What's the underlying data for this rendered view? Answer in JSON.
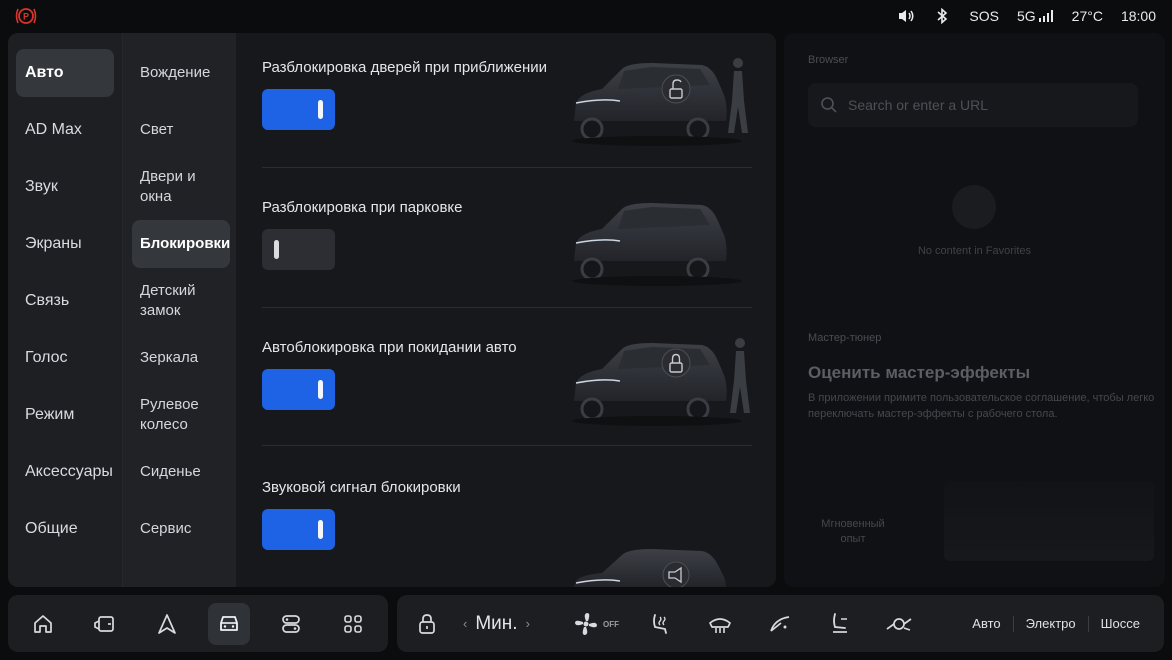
{
  "status": {
    "sos": "SOS",
    "network": "5G",
    "temperature": "27°C",
    "time": "18:00",
    "icons": [
      "parking-brake-icon",
      "volume-icon",
      "bluetooth-icon",
      "signal-icon"
    ],
    "alert_color": "#d9342b"
  },
  "nav_main": {
    "items": [
      "Авто",
      "AD Max",
      "Звук",
      "Экраны",
      "Связь",
      "Голос",
      "Режим",
      "Аксессуары",
      "Общие"
    ],
    "active": "Авто"
  },
  "nav_sub": {
    "items": [
      "Вождение",
      "Свет",
      "Двери и окна",
      "Блокировки",
      "Детский замок",
      "Зеркала",
      "Рулевое колесо",
      "Сиденье",
      "Сервис"
    ],
    "active": "Блокировки"
  },
  "settings": [
    {
      "label": "Разблокировка дверей при приближении",
      "enabled": true,
      "illustration": "car-unlock-person-icon"
    },
    {
      "label": "Разблокировка при парковке",
      "enabled": false,
      "illustration": "car-icon"
    },
    {
      "label": "Автоблокировка при покидании авто",
      "enabled": true,
      "illustration": "car-lock-person-icon"
    },
    {
      "label": "Звуковой сигнал блокировки",
      "enabled": true,
      "illustration": "car-horn-icon"
    }
  ],
  "accent_color": "#1e63e6",
  "browser": {
    "title": "Browser",
    "placeholder": "Search or enter a URL",
    "empty_text": "No content in Favorites"
  },
  "tuner": {
    "title": "Мастер-тюнер",
    "heading": "Оценить мастер-эффекты",
    "description": "В приложении примите пользовательское соглашение, чтобы легко переключать мастер-эффекты с рабочего стола.",
    "instant_label": "Мгновенный опыт"
  },
  "dock": {
    "apps": [
      "home-icon",
      "door-icon",
      "navigation-icon",
      "car-icon",
      "media-icon",
      "apps-grid-icon"
    ],
    "active_app": "car-icon",
    "fan_mode": "Мин.",
    "fan_off_label": "OFF",
    "climate_icons": [
      "lock-icon",
      "fan-icon",
      "seat-heat-icon",
      "rear-defrost-icon",
      "wiper-icon",
      "seat-icon",
      "steering-heat-icon"
    ],
    "drive_modes": [
      "Авто",
      "Электро",
      "Шоссе"
    ]
  }
}
